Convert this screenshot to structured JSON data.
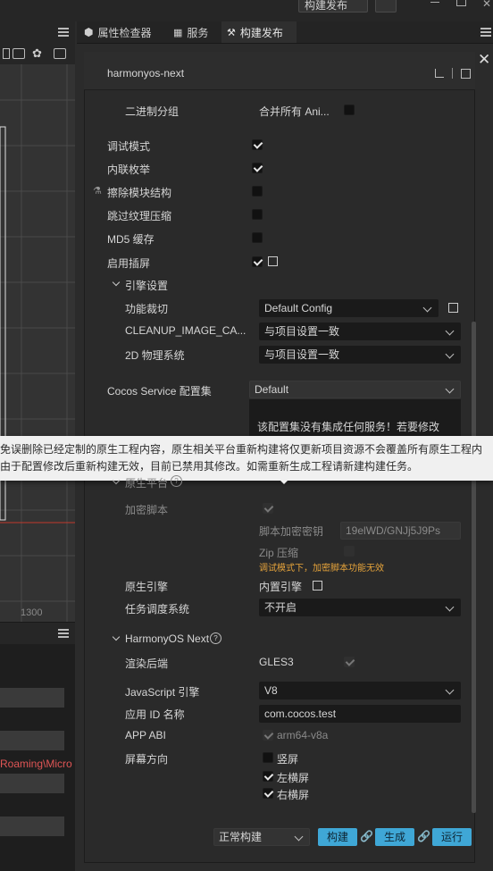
{
  "topbar": {
    "build_publish_button": "构建发布"
  },
  "tabs": [
    {
      "label": "属性检查器"
    },
    {
      "label": "服务"
    },
    {
      "label": "构建发布"
    }
  ],
  "left": {
    "ruler_value": "1300",
    "path_fragment": "Roaming\\Micro"
  },
  "panel": {
    "title": "harmonyos-next",
    "binary_group_label": "二进制分组",
    "merge_all_label": "合并所有 Ani...",
    "debug_mode": "调试模式",
    "inline_enum": "内联枚举",
    "erase_module": "擦除模块结构",
    "skip_texture": "跳过纹理压缩",
    "md5_cache": "MD5 缓存",
    "enable_splash": "启用插屏",
    "engine_settings": "引擎设置",
    "feature_crop": "功能裁切",
    "feature_crop_value": "Default Config",
    "cleanup_label": "CLEANUP_IMAGE_CA...",
    "cleanup_value": "与项目设置一致",
    "physics_2d": "2D 物理系统",
    "physics_2d_value": "与项目设置一致",
    "cocos_service": "Cocos Service 配置集",
    "cocos_service_value": "Default",
    "service_note": "该配置集没有集成任何服务！若要修改",
    "native_platform": "原生平台",
    "encrypt_script": "加密脚本",
    "encrypt_key_label": "脚本加密密钥",
    "encrypt_key_value": "19elWD/GNJj5J9Ps",
    "zip_compress": "Zip 压缩",
    "encrypt_warning": "调试模式下，加密脚本功能无效",
    "native_engine": "原生引擎",
    "native_engine_value": "内置引擎",
    "task_scheduler": "任务调度系统",
    "task_scheduler_value": "不开启",
    "harmony_section": "HarmonyOS Next",
    "render_backend": "渲染后端",
    "render_backend_value": "GLES3",
    "js_engine": "JavaScript 引擎",
    "js_engine_value": "V8",
    "app_id_label": "应用 ID 名称",
    "app_id_value": "com.cocos.test",
    "app_abi": "APP ABI",
    "app_abi_value": "arm64-v8a",
    "screen_orientation": "屏幕方向",
    "portrait": "竖屏",
    "landscape_left": "左横屏",
    "landscape_right": "右横屏",
    "build_mode": "正常构建",
    "build_btn": "构建",
    "make_btn": "生成",
    "run_btn": "运行"
  },
  "tooltip": {
    "line1": "免误删除已经定制的原生工程内容，原生相关平台重新构建将仅更新项目资源不会覆盖所有原生工程内",
    "line2": "由于配置修改后重新构建无效，目前已禁用其修改。如需重新生成工程请新建构建任务。"
  },
  "colors": {
    "accent": "#3fa7d6",
    "warning": "#e5a33b",
    "red_line": "#c0392b"
  }
}
